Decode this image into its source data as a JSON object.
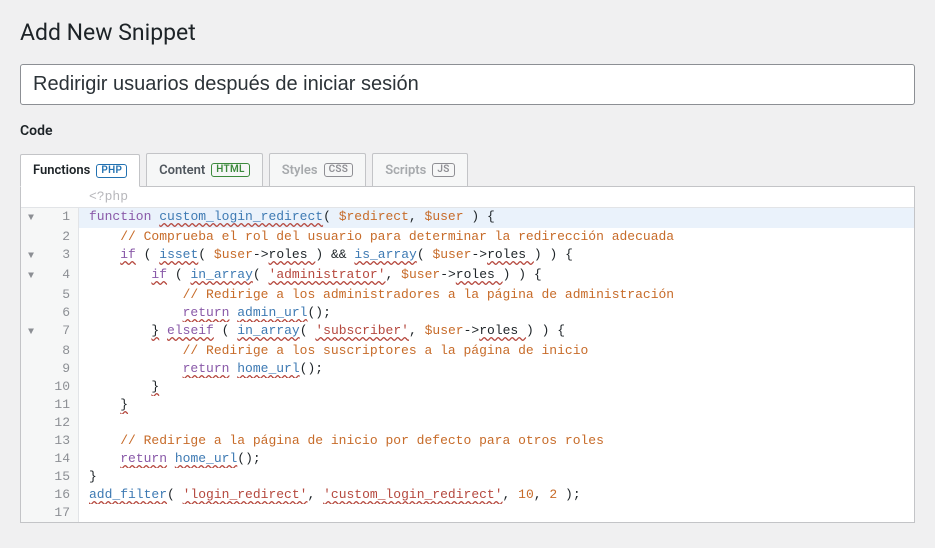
{
  "page_title": "Add New Snippet",
  "snippet_title": "Redirigir usuarios después de iniciar sesión",
  "section_heading": "Code",
  "php_open": "<?php",
  "tabs": [
    {
      "label": "Functions",
      "badge": "PHP",
      "badge_class": "badge-php",
      "active": true,
      "disabled": false
    },
    {
      "label": "Content",
      "badge": "HTML",
      "badge_class": "badge-html",
      "active": false,
      "disabled": false
    },
    {
      "label": "Styles",
      "badge": "CSS",
      "badge_class": "badge-css",
      "active": false,
      "disabled": true
    },
    {
      "label": "Scripts",
      "badge": "JS",
      "badge_class": "badge-js",
      "active": false,
      "disabled": true
    }
  ],
  "code_lines": [
    {
      "n": 1,
      "fold": true,
      "active": true,
      "html": "<span class='kw'>function</span> <span class='fn wavy'>custom_login_redirect</span><span class='punc'>(</span> <span class='var'>$redirect</span><span class='punc'>,</span> <span class='var'>$user</span> <span class='punc'>)</span> <span class='punc'>{</span>"
    },
    {
      "n": 2,
      "fold": false,
      "active": false,
      "html": "    <span class='cmt'>// Comprueba el rol del usuario para determinar la redirección adecuada</span>"
    },
    {
      "n": 3,
      "fold": true,
      "active": false,
      "html": "    <span class='kw wavy'>if</span> <span class='punc'>(</span> <span class='fn wavy'>isset</span><span class='punc'>(</span> <span class='var'>$user</span><span class='op'>-&gt;</span><span class='wavy'>roles </span><span class='punc'>)</span> <span class='op'>&amp;&amp;</span> <span class='fn wavy'>is_array</span><span class='punc'>(</span> <span class='var'>$user</span><span class='op'>-&gt;</span><span class='wavy'>roles </span><span class='punc'>)</span> <span class='punc'>)</span> <span class='punc'>{</span>"
    },
    {
      "n": 4,
      "fold": true,
      "active": false,
      "html": "        <span class='kw wavy'>if</span> <span class='punc'>(</span> <span class='fn wavy'>in_array</span><span class='punc'>(</span> <span class='str wavy'>'administrator'</span><span class='punc'>,</span> <span class='var'>$user</span><span class='op'>-&gt;</span><span class='wavy'>roles </span><span class='punc'>)</span> <span class='punc'>)</span> <span class='punc'>{</span>"
    },
    {
      "n": 5,
      "fold": false,
      "active": false,
      "html": "            <span class='cmt'>// Redirige a los administradores a la página de administración</span>"
    },
    {
      "n": 6,
      "fold": false,
      "active": false,
      "html": "            <span class='kw wavy'>return</span> <span class='fn wavy'>admin_url</span><span class='punc'>();</span>"
    },
    {
      "n": 7,
      "fold": true,
      "active": false,
      "html": "        <span class='punc wavy'>}</span> <span class='kw wavy'>elseif</span> <span class='punc'>(</span> <span class='fn wavy'>in_array</span><span class='punc'>(</span> <span class='str wavy'>'subscriber'</span><span class='punc'>,</span> <span class='var'>$user</span><span class='op'>-&gt;</span><span class='wavy'>roles </span><span class='punc'>)</span> <span class='punc'>)</span> <span class='punc'>{</span>"
    },
    {
      "n": 8,
      "fold": false,
      "active": false,
      "html": "            <span class='cmt'>// Redirige a los suscriptores a la página de inicio</span>"
    },
    {
      "n": 9,
      "fold": false,
      "active": false,
      "html": "            <span class='kw wavy'>return</span> <span class='fn wavy'>home_url</span><span class='punc'>();</span>"
    },
    {
      "n": 10,
      "fold": false,
      "active": false,
      "html": "        <span class='punc wavy'>}</span>"
    },
    {
      "n": 11,
      "fold": false,
      "active": false,
      "html": "    <span class='punc wavy'>}</span>"
    },
    {
      "n": 12,
      "fold": false,
      "active": false,
      "html": ""
    },
    {
      "n": 13,
      "fold": false,
      "active": false,
      "html": "    <span class='cmt'>// Redirige a la página de inicio por defecto para otros roles</span>"
    },
    {
      "n": 14,
      "fold": false,
      "active": false,
      "html": "    <span class='kw wavy'>return</span> <span class='fn wavy'>home_url</span><span class='punc'>();</span>"
    },
    {
      "n": 15,
      "fold": false,
      "active": false,
      "html": "<span class='punc'>}</span>"
    },
    {
      "n": 16,
      "fold": false,
      "active": false,
      "html": "<span class='fn wavy'>add_filter</span><span class='punc'>(</span> <span class='str wavy'>'login_redirect'</span><span class='punc'>,</span> <span class='str wavy'>'custom_login_redirect'</span><span class='punc'>,</span> <span class='num'>10</span><span class='punc'>,</span> <span class='num'>2</span> <span class='punc'>);</span>"
    },
    {
      "n": 17,
      "fold": false,
      "active": false,
      "html": ""
    }
  ]
}
